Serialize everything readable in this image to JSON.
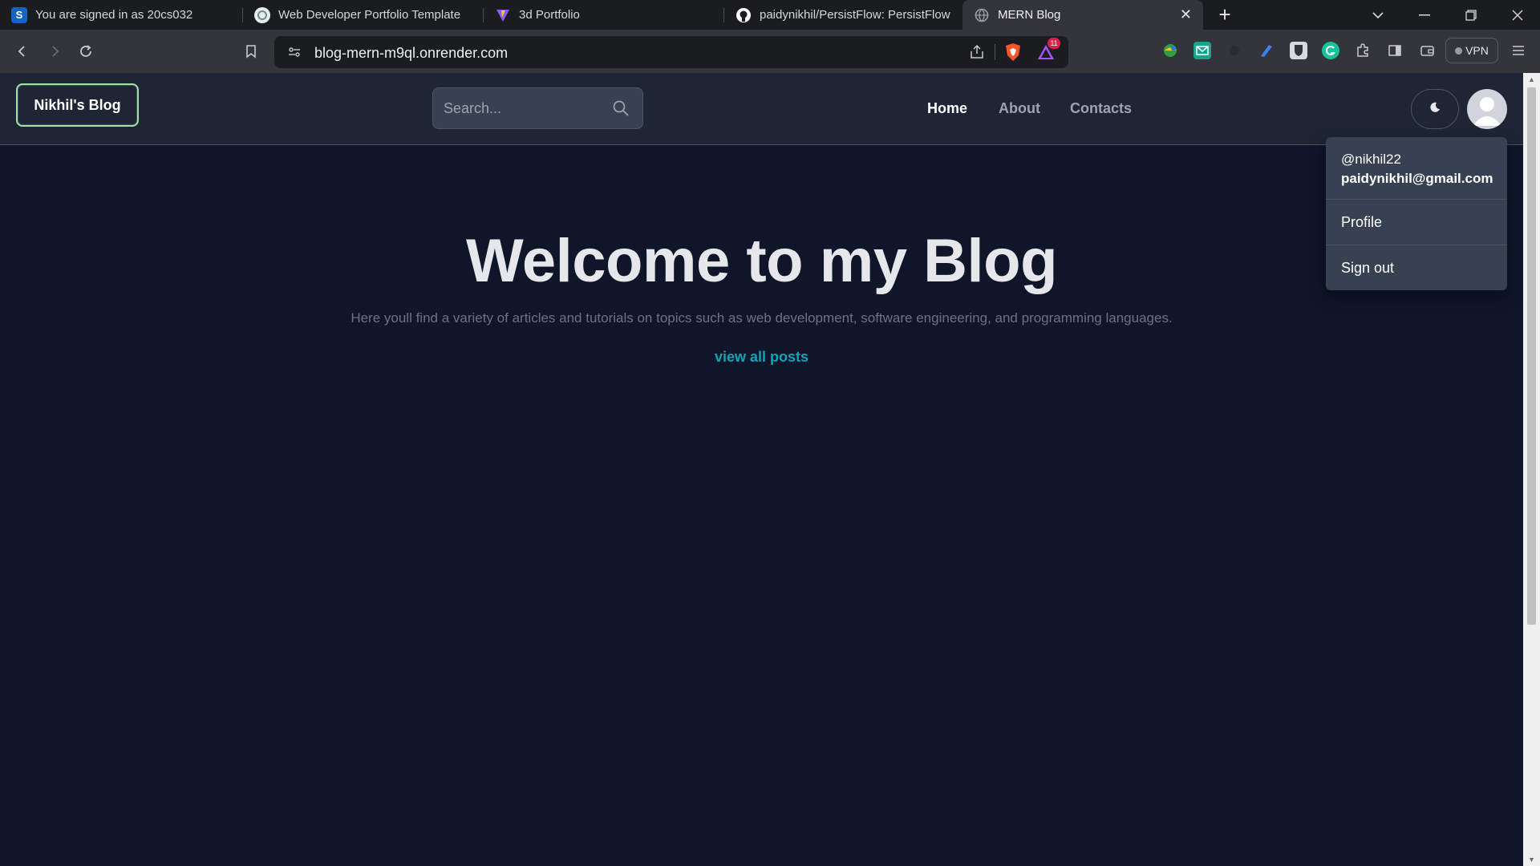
{
  "browser": {
    "tabs": [
      {
        "title": "You are signed in as 20cs032",
        "icon": "s-icon",
        "color": "#1565c0"
      },
      {
        "title": "Web Developer Portfolio Template",
        "icon": "chatgpt-icon",
        "color": "#6b8f80"
      },
      {
        "title": "3d Portfolio",
        "icon": "vite-icon",
        "color": "#8a5cf6"
      },
      {
        "title": "paidynikhil/PersistFlow: PersistFlow is y",
        "icon": "github-icon",
        "color": "#ffffff"
      },
      {
        "title": "MERN Blog",
        "icon": "globe-icon",
        "color": "#9aa0a6"
      }
    ],
    "new_tab_label": "+",
    "url": "blog-mern-m9ql.onrender.com",
    "brave_badge_count": "11",
    "vpn_label": "VPN"
  },
  "site": {
    "logo": "Nikhil's Blog",
    "search_placeholder": "Search...",
    "nav": {
      "home": "Home",
      "about": "About",
      "contacts": "Contacts"
    },
    "user_menu": {
      "username": "@nikhil22",
      "email": "paidynikhil@gmail.com",
      "profile": "Profile",
      "sign_out": "Sign out"
    }
  },
  "hero": {
    "title": "Welcome to my Blog",
    "subtitle": "Here youll find a variety of articles and tutorials on topics such as web development, software engineering, and programming languages.",
    "link": "view all posts"
  },
  "colors": {
    "page_bg": "#0f1629",
    "header_bg": "#1e2636",
    "accent_link": "#0ea5b7",
    "logo_border": "#a3e0a8"
  }
}
